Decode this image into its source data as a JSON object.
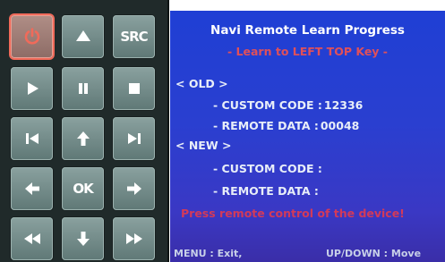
{
  "keypad": {
    "keys": [
      {
        "name": "power-button",
        "icon": "power-icon"
      },
      {
        "name": "eject-button",
        "icon": "eject-icon"
      },
      {
        "name": "src-button",
        "label": "SRC"
      },
      {
        "name": "play-button",
        "icon": "play-icon"
      },
      {
        "name": "pause-button",
        "icon": "pause-icon"
      },
      {
        "name": "stop-button",
        "icon": "stop-icon"
      },
      {
        "name": "previous-track-button",
        "icon": "skip-back-icon"
      },
      {
        "name": "up-button",
        "icon": "arrow-up-icon"
      },
      {
        "name": "next-track-button",
        "icon": "skip-forward-icon"
      },
      {
        "name": "left-button",
        "icon": "arrow-left-icon"
      },
      {
        "name": "ok-button",
        "label": "OK"
      },
      {
        "name": "right-button",
        "icon": "arrow-right-icon"
      },
      {
        "name": "rewind-button",
        "icon": "rewind-icon"
      },
      {
        "name": "down-button",
        "icon": "arrow-down-icon"
      },
      {
        "name": "fast-forward-button",
        "icon": "fast-forward-icon"
      }
    ]
  },
  "screen": {
    "title": "Navi Remote Learn Progress",
    "subtitle": "- Learn to LEFT TOP Key -",
    "old_header": "< OLD >",
    "old_custom_code_label": "- CUSTOM CODE :",
    "old_custom_code_value": "12336",
    "old_remote_data_label": "- REMOTE DATA :",
    "old_remote_data_value": "00048",
    "new_header": "< NEW >",
    "new_custom_code_label": "- CUSTOM CODE :",
    "new_remote_data_label": "- REMOTE DATA :",
    "notice": "Press remote control of the device!",
    "footer_left": "MENU : Exit,",
    "footer_right": "UP/DOWN : Move"
  },
  "colors": {
    "keypad_bg": "#202a2a",
    "key_face": "#7a918f",
    "power_highlight": "#f06a5a",
    "screen_bg": "#2a3fd0",
    "subtitle": "#e0505a",
    "notice": "#d23a5a"
  }
}
